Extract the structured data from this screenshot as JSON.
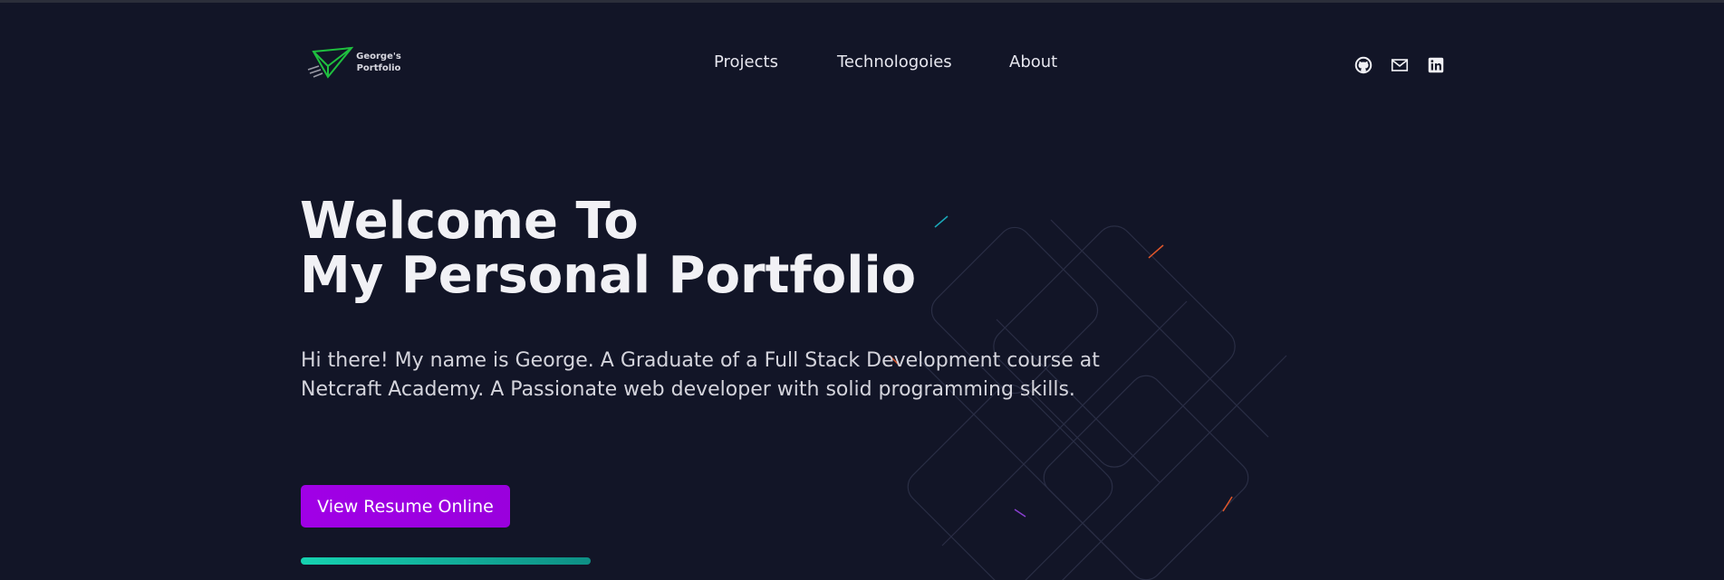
{
  "header": {
    "logo_line1": "George's",
    "logo_line2": "Portfolio",
    "nav": [
      {
        "label": "Projects"
      },
      {
        "label": "Technologoies"
      },
      {
        "label": "About"
      }
    ],
    "social_icons": [
      "github-icon",
      "mail-icon",
      "linkedin-icon"
    ]
  },
  "hero": {
    "title_line1": "Welcome To",
    "title_line2": "My Personal Portfolio",
    "description": "Hi there! My name is George. A Graduate of a Full Stack Development course at Netcraft Academy. A Passionate web developer with solid programming skills.",
    "cta_label": "View Resume Online"
  },
  "colors": {
    "background": "#121527",
    "accent_purple": "#a000e6",
    "accent_teal": "#16d1b0",
    "logo_green": "#1fbf3f"
  }
}
